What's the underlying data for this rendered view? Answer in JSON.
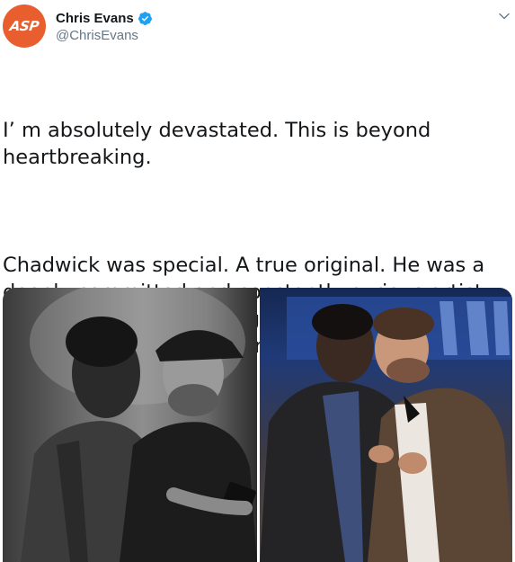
{
  "user": {
    "display_name": "Chris Evans",
    "handle": "@ChrisEvans",
    "avatar_text": "ASP",
    "verified": true
  },
  "tweet": {
    "paragraph_1": "I’ m absolutely devastated. This is beyond heartbreaking.",
    "paragraph_2": "Chadwick was special. A true original. He was a deeply committed and constantly curious artist. He had so much amazing work still left to create. I’ m endlessly grateful for our friendship. Rest in power, King"
  },
  "icons": {
    "verified": "verified-badge-icon",
    "menu": "chevron-down-icon",
    "emoji": "blue-heart-icon"
  },
  "colors": {
    "avatar_bg": "#e85e2e",
    "verified_blue": "#1da1f2",
    "heart_blue": "#5dadec",
    "handle_gray": "#657786",
    "text": "#14171a"
  },
  "media": [
    {
      "name": "photo-left",
      "style": "black-and-white"
    },
    {
      "name": "photo-right",
      "style": "color"
    }
  ]
}
